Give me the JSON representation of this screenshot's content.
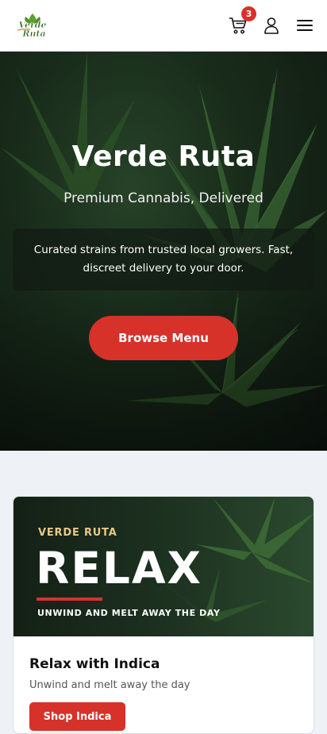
{
  "header": {
    "logo_line1": "Verde",
    "logo_line2": "Ruta",
    "cart_count": "3",
    "icons": [
      "cart-icon",
      "user-icon",
      "menu-icon"
    ]
  },
  "hero": {
    "title": "Verde Ruta",
    "subtitle": "Premium Cannabis, Delivered",
    "description": "Curated strains from trusted local growers. Fast, discreet delivery to your door.",
    "cta_label": "Browse Menu"
  },
  "promo": {
    "banner_kicker": "VERDE RUTA",
    "banner_headline": "RELAX",
    "banner_tagline": "UNWIND AND MELT AWAY THE DAY",
    "title": "Relax with Indica",
    "subtitle": "Unwind and melt away the day",
    "cta_label": "Shop Indica"
  },
  "colors": {
    "accent": "#d6322a",
    "header_bg": "#ffffff",
    "page_bg": "#eef2f6",
    "kicker_gold": "#e7c98a"
  }
}
